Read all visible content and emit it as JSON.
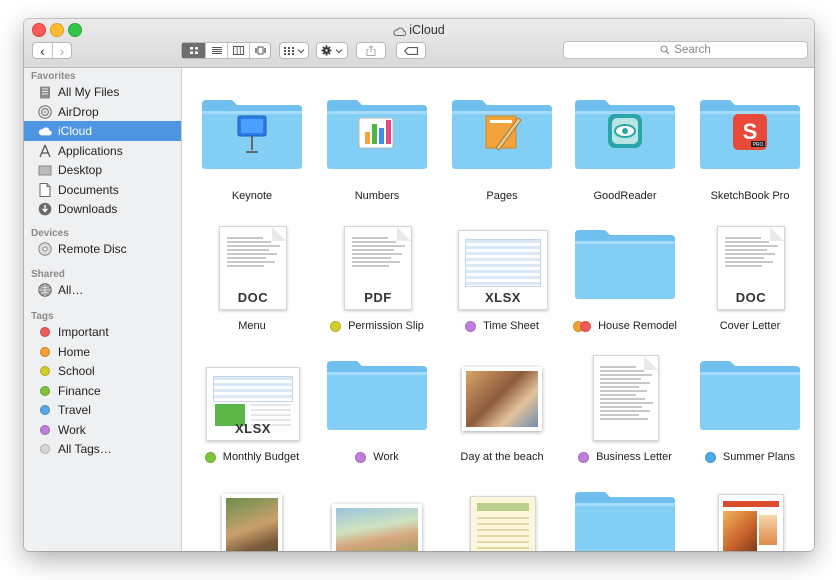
{
  "window": {
    "title": "iCloud"
  },
  "toolbar": {
    "search_placeholder": "Search",
    "back_label": "‹",
    "forward_label": "›"
  },
  "sidebar": {
    "sections": [
      {
        "title": "Favorites",
        "items": [
          {
            "label": "All My Files",
            "icon": "all-my-files-icon"
          },
          {
            "label": "AirDrop",
            "icon": "airdrop-icon"
          },
          {
            "label": "iCloud",
            "icon": "icloud-icon",
            "selected": true
          },
          {
            "label": "Applications",
            "icon": "applications-icon"
          },
          {
            "label": "Desktop",
            "icon": "desktop-icon"
          },
          {
            "label": "Documents",
            "icon": "documents-icon"
          },
          {
            "label": "Downloads",
            "icon": "downloads-icon"
          }
        ]
      },
      {
        "title": "Devices",
        "items": [
          {
            "label": "Remote Disc",
            "icon": "remote-disc-icon"
          }
        ]
      },
      {
        "title": "Shared",
        "items": [
          {
            "label": "All…",
            "icon": "network-globe-icon"
          }
        ]
      },
      {
        "title": "Tags",
        "items": [
          {
            "label": "Important",
            "color": "#f05a5a"
          },
          {
            "label": "Home",
            "color": "#f5a033"
          },
          {
            "label": "School",
            "color": "#d2cc2c"
          },
          {
            "label": "Finance",
            "color": "#7cc43a"
          },
          {
            "label": "Travel",
            "color": "#4fa9ea"
          },
          {
            "label": "Work",
            "color": "#c07ddf"
          },
          {
            "label": "All Tags…",
            "color": "#d6d6d6"
          }
        ]
      }
    ]
  },
  "files": [
    {
      "label": "Keynote",
      "kind": "folder",
      "badge": "keynote"
    },
    {
      "label": "Numbers",
      "kind": "folder",
      "badge": "numbers"
    },
    {
      "label": "Pages",
      "kind": "folder",
      "badge": "pages"
    },
    {
      "label": "GoodReader",
      "kind": "folder",
      "badge": "goodreader"
    },
    {
      "label": "SketchBook Pro",
      "kind": "folder",
      "badge": "sketchbook"
    },
    {
      "label": "Menu",
      "kind": "doc",
      "ext": "DOC"
    },
    {
      "label": "Permission Slip",
      "kind": "doc",
      "ext": "PDF",
      "tags": [
        "#d2cc2c"
      ]
    },
    {
      "label": "Time Sheet",
      "kind": "sheet",
      "ext": "XLSX",
      "tags": [
        "#c07ddf"
      ]
    },
    {
      "label": "House Remodel",
      "kind": "folder",
      "tags": [
        "#f5a033",
        "#f05a5a"
      ]
    },
    {
      "label": "Cover Letter",
      "kind": "doc",
      "ext": "DOC"
    },
    {
      "label": "Monthly Budget",
      "kind": "sheet-landscape",
      "ext": "XLSX",
      "tags": [
        "#7cc43a"
      ]
    },
    {
      "label": "Work",
      "kind": "folder",
      "tags": [
        "#c07ddf"
      ]
    },
    {
      "label": "Day at the beach",
      "kind": "photo-landscape"
    },
    {
      "label": "Business Letter",
      "kind": "letter",
      "tags": [
        "#c07ddf"
      ]
    },
    {
      "label": "Summer Plans",
      "kind": "folder",
      "tags": [
        "#4fa9ea"
      ]
    },
    {
      "label": "",
      "kind": "photo-portrait"
    },
    {
      "label": "",
      "kind": "photo-landscape2"
    },
    {
      "label": "",
      "kind": "brochure"
    },
    {
      "label": "",
      "kind": "folder"
    },
    {
      "label": "",
      "kind": "catering"
    }
  ]
}
